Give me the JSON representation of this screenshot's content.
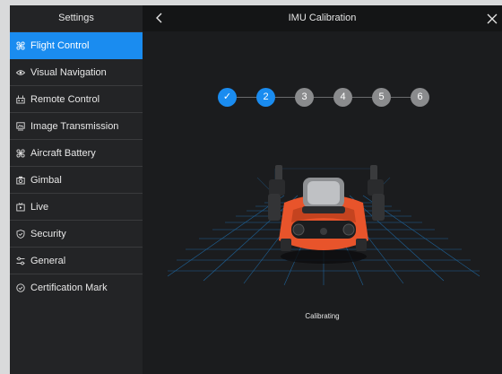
{
  "sidebar": {
    "title": "Settings",
    "items": [
      {
        "label": "Flight Control",
        "icon": "flight-control-icon",
        "active": true
      },
      {
        "label": "Visual Navigation",
        "icon": "eye-icon"
      },
      {
        "label": "Remote Control",
        "icon": "remote-control-icon"
      },
      {
        "label": "Image Transmission",
        "icon": "image-transmission-icon"
      },
      {
        "label": "Aircraft Battery",
        "icon": "battery-icon"
      },
      {
        "label": "Gimbal",
        "icon": "gimbal-icon"
      },
      {
        "label": "Live",
        "icon": "live-icon"
      },
      {
        "label": "Security",
        "icon": "shield-icon"
      },
      {
        "label": "General",
        "icon": "sliders-icon"
      },
      {
        "label": "Certification Mark",
        "icon": "certification-icon"
      }
    ]
  },
  "header": {
    "title": "IMU Calibration",
    "back_icon": "chevron-left-icon",
    "close_icon": "close-icon"
  },
  "steps": [
    {
      "label": "✓",
      "state": "done"
    },
    {
      "label": "2",
      "state": "active"
    },
    {
      "label": "3",
      "state": "pending"
    },
    {
      "label": "4",
      "state": "pending"
    },
    {
      "label": "5",
      "state": "pending"
    },
    {
      "label": "6",
      "state": "pending"
    }
  ],
  "status": "Calibrating",
  "colors": {
    "accent": "#1a8cf0",
    "drone_body": "#e8542b",
    "grid": "#1f6fae"
  }
}
